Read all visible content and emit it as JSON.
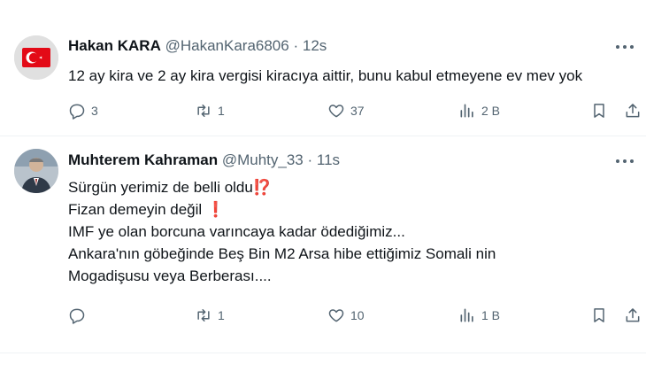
{
  "tweets": [
    {
      "author": {
        "name": "Hakan KARA",
        "handle": "@HakanKara6806"
      },
      "separator": "·",
      "time": "12s",
      "lines": [
        "12 ay kira ve 2 ay kira vergisi kiracıya aittir, bunu kabul etmeyene ev mev yok"
      ],
      "stats": {
        "replies": "3",
        "retweets": "1",
        "likes": "37",
        "views": "2 B"
      },
      "icons": {
        "avatar": "turkish-flag-avatar",
        "more": "more-icon",
        "reply": "reply-icon",
        "retweet": "retweet-icon",
        "like": "heart-icon",
        "views": "views-icon",
        "bookmark": "bookmark-icon",
        "share": "share-icon"
      }
    },
    {
      "author": {
        "name": "Muhterem Kahraman",
        "handle": "@Muhty_33"
      },
      "separator": "·",
      "time": "11s",
      "lines": [
        "Sürgün yerimiz de belli oldu",
        "Fizan demeyin değil",
        "IMF ye olan borcuna varıncaya kadar ödediğimiz...",
        "Ankara'nın göbeğinde Beş Bin M2 Arsa hibe ettiğimiz Somali nin",
        "Mogadişusu veya Berberası...."
      ],
      "emojis": {
        "line1": "⁉️",
        "line2": "❗"
      },
      "stats": {
        "replies": "",
        "retweets": "1",
        "likes": "10",
        "views": "1 B"
      },
      "icons": {
        "avatar": "person-photo-avatar",
        "more": "more-icon",
        "reply": "reply-icon",
        "retweet": "retweet-icon",
        "like": "heart-icon",
        "views": "views-icon",
        "bookmark": "bookmark-icon",
        "share": "share-icon"
      }
    }
  ],
  "colors": {
    "text": "#0f1419",
    "secondary": "#536471",
    "divider": "#eff3f4",
    "emoji_red": "#d7263d"
  }
}
